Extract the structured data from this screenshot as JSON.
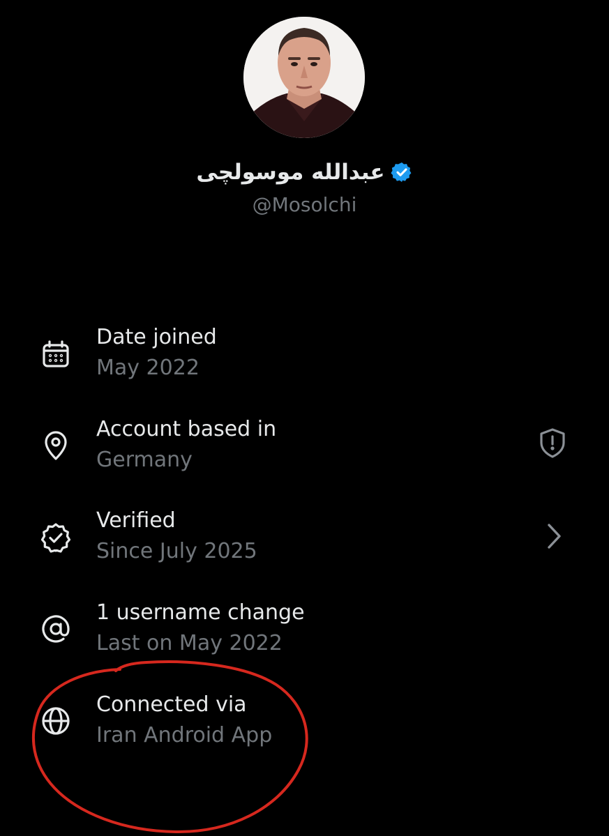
{
  "profile": {
    "display_name": "عبدالله موسولچی",
    "handle": "@Mosolchi",
    "verified": true,
    "badge_color": "#1d9bf0"
  },
  "about": {
    "rows": [
      {
        "icon": "calendar-icon",
        "title": "Date joined",
        "subtitle": "May 2022"
      },
      {
        "icon": "location-pin-icon",
        "title": "Account based in",
        "subtitle": "Germany",
        "trailing_icon": "shield-alert-icon"
      },
      {
        "icon": "verified-badge-icon",
        "title": "Verified",
        "subtitle": "Since July 2025",
        "trailing_icon": "chevron-right-icon"
      },
      {
        "icon": "at-sign-icon",
        "title": "1 username change",
        "subtitle": "Last on May 2022"
      },
      {
        "icon": "globe-icon",
        "title": "Connected via",
        "subtitle": "Iran Android App"
      }
    ]
  },
  "colors": {
    "background": "#000000",
    "primary_text": "#e7e9ea",
    "secondary_text": "#71767b",
    "annotation_circle": "#d6281e"
  }
}
